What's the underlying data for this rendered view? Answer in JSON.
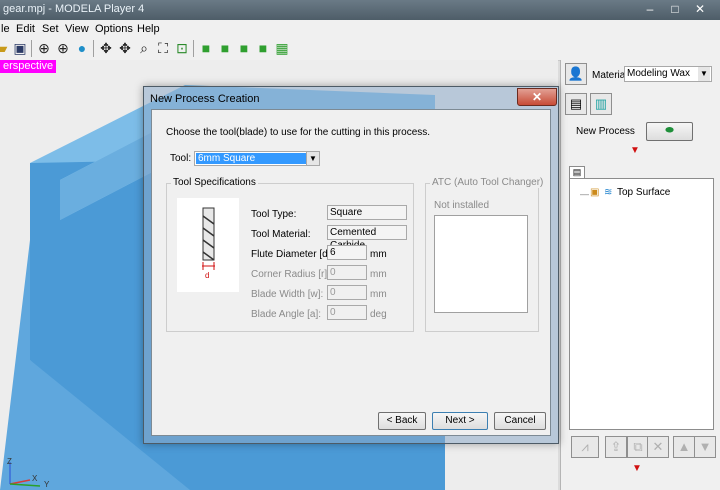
{
  "window": {
    "title": "gear.mpj - MODELA Player 4"
  },
  "menu": [
    "le",
    "Edit",
    "Set",
    "View",
    "Options",
    "Help"
  ],
  "viewport": {
    "label": "erspective",
    "axes": {
      "z": "Z",
      "x": "X",
      "y": "Y"
    }
  },
  "right_panel": {
    "material_label": "Material",
    "material_value": "Modeling Wax",
    "new_process_label": "New Process",
    "tree_item": "Top Surface"
  },
  "dialog": {
    "title": "New Process Creation",
    "close_glyph": "✕",
    "instruction": "Choose the tool(blade) to use for the cutting in this process.",
    "tool_label": "Tool:",
    "tool_value": "6mm Square",
    "spec_group": "Tool Specifications",
    "diagram_label": "d",
    "specs": {
      "tool_type_label": "Tool Type:",
      "tool_type_value": "Square",
      "material_label": "Tool Material:",
      "material_value": "Cemented Carbide",
      "flute_label": "Flute Diameter [d]:",
      "flute_value": "6",
      "flute_unit": "mm",
      "corner_label": "Corner Radius [r]:",
      "corner_value": "0",
      "corner_unit": "mm",
      "width_label": "Blade Width [w]:",
      "width_value": "0",
      "width_unit": "mm",
      "angle_label": "Blade Angle [a]:",
      "angle_value": "0",
      "angle_unit": "deg"
    },
    "atc_group": "ATC (Auto Tool Changer)",
    "atc_status": "Not installed",
    "back_button": "< Back",
    "next_button": "Next >",
    "cancel_button": "Cancel"
  }
}
